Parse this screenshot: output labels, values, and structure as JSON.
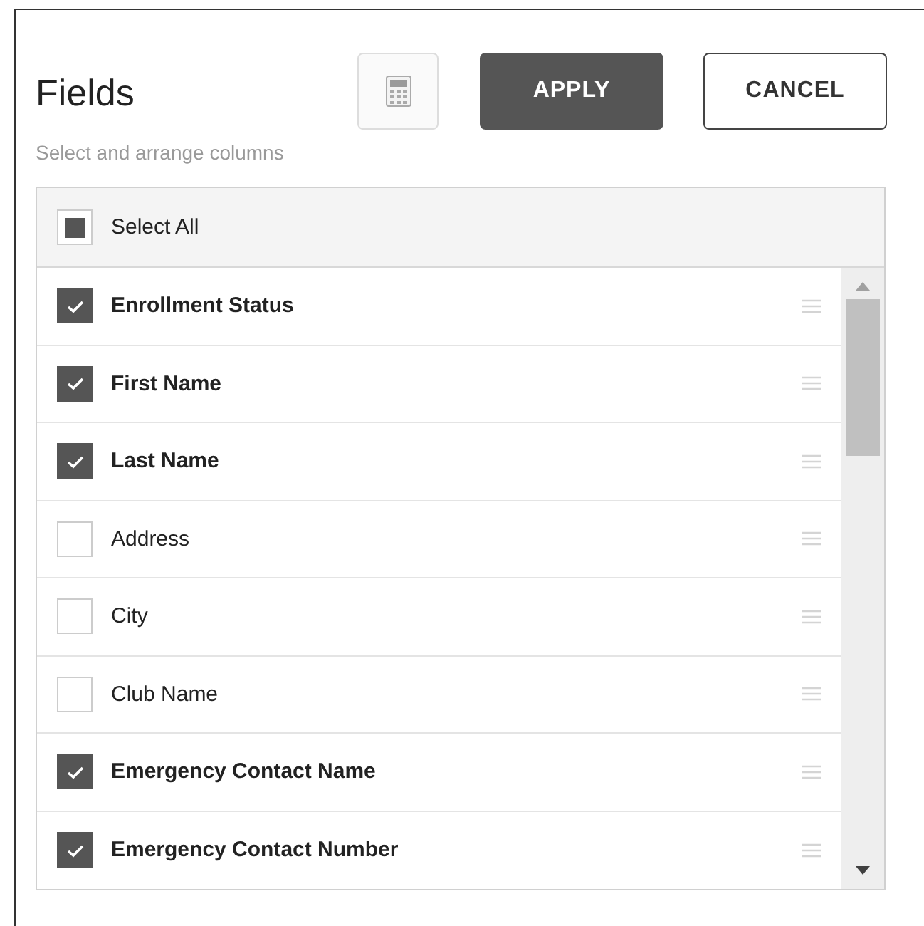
{
  "title": "Fields",
  "buttons": [
    {
      "kind": "icon"
    },
    {
      "kind": "primary",
      "label": "APPLY"
    },
    {
      "kind": "secondary",
      "label": "CANCEL"
    }
  ],
  "subtitle": "Select and arrange columns",
  "select_all": {
    "label": "Select All",
    "indeterminate": true
  },
  "fields": [
    {
      "label": "Enrollment Status",
      "checked": true
    },
    {
      "label": "First Name",
      "checked": true
    },
    {
      "label": "Last Name",
      "checked": true
    },
    {
      "label": "Address",
      "checked": false
    },
    {
      "label": "City",
      "checked": false
    },
    {
      "label": "Club Name",
      "checked": false
    },
    {
      "label": "Emergency Contact Name",
      "checked": true
    },
    {
      "label": "Emergency Contact Number",
      "checked": true
    }
  ]
}
